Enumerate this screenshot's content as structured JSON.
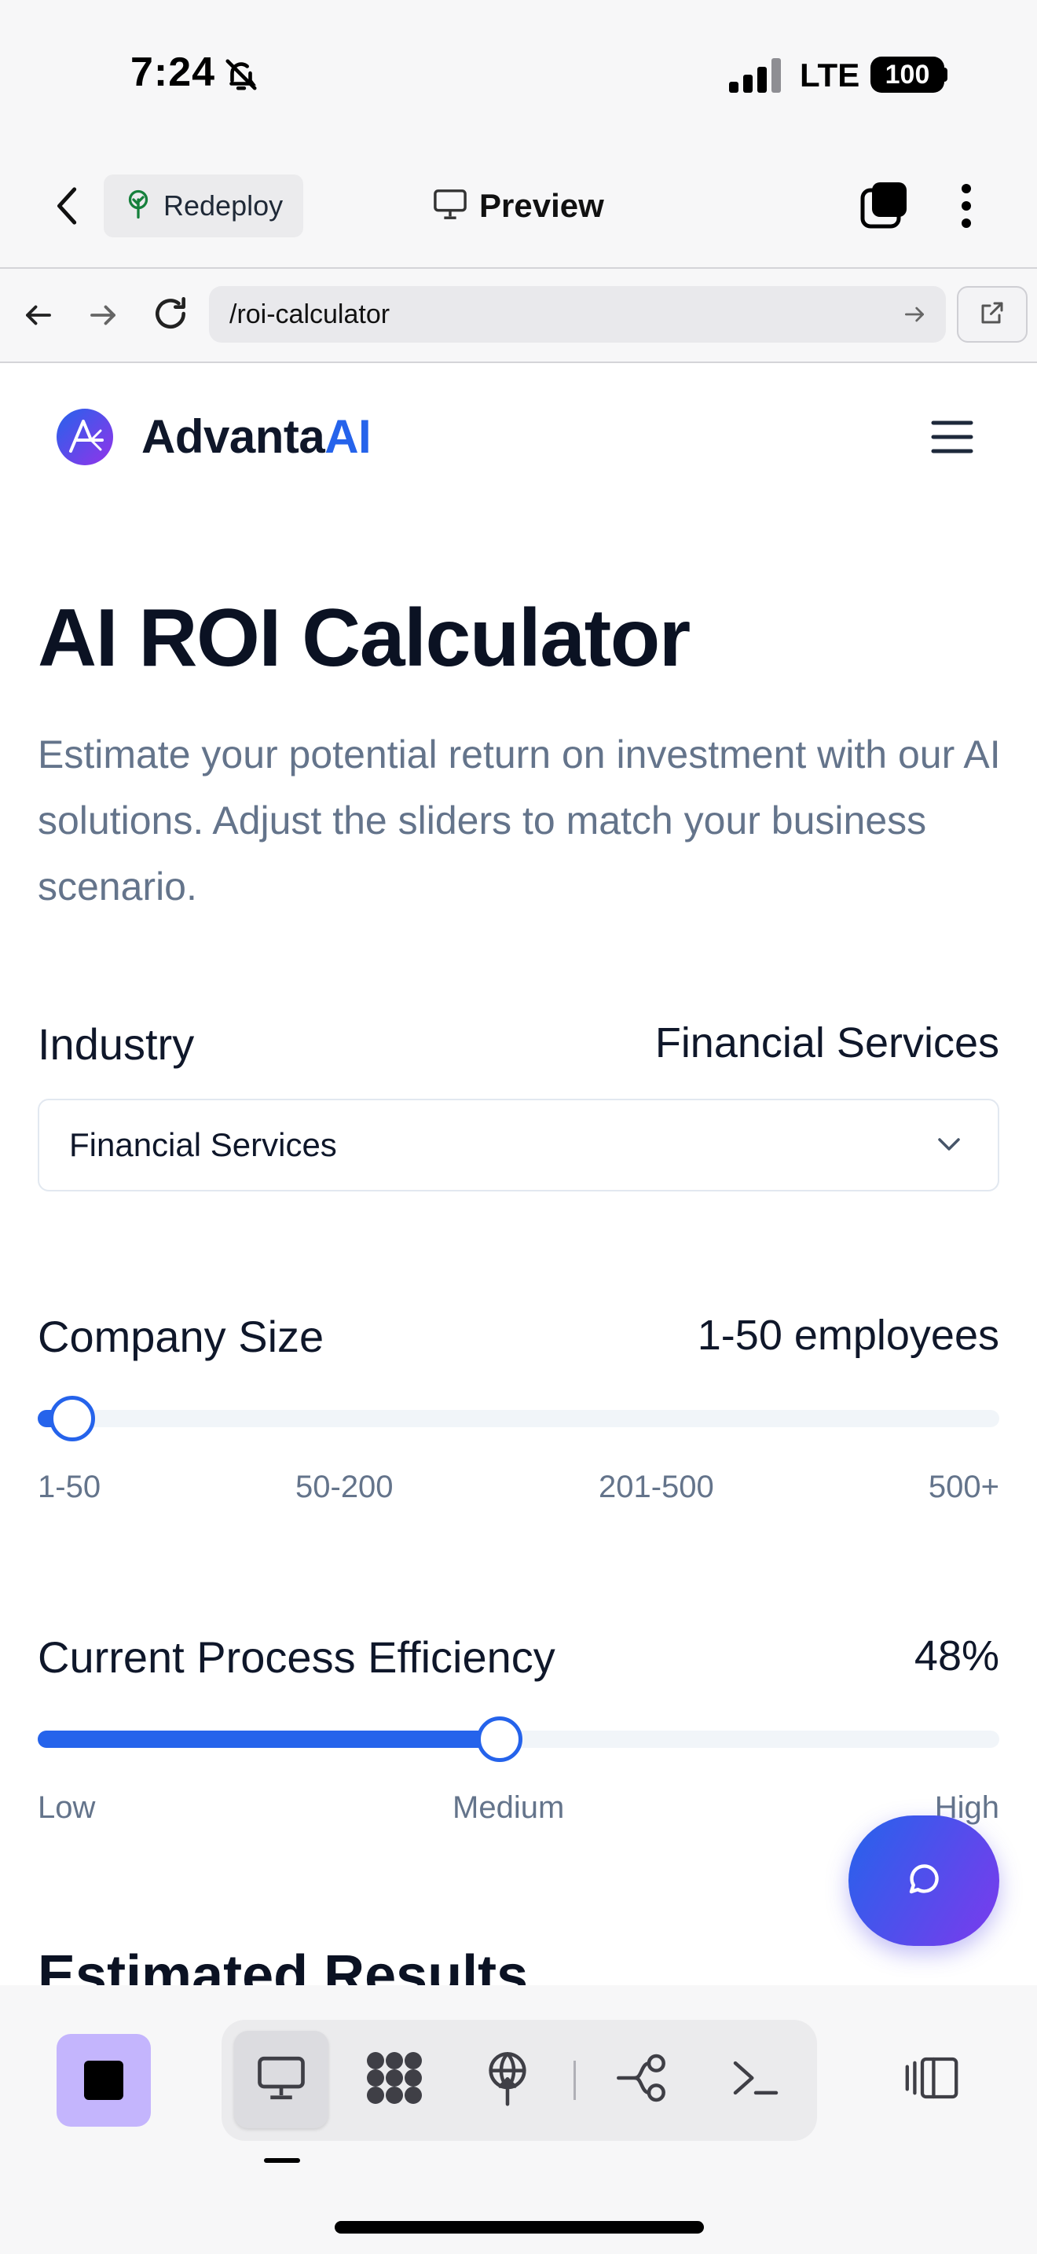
{
  "status_bar": {
    "time": "7:24",
    "network": "LTE",
    "battery": "100"
  },
  "app_bar": {
    "redeploy_label": "Redeploy",
    "preview_label": "Preview"
  },
  "browser": {
    "url": "/roi-calculator"
  },
  "site": {
    "brand_main": "Advanta",
    "brand_accent": "AI",
    "brand_color": "#2563eb"
  },
  "page": {
    "title": "AI ROI Calculator",
    "subtitle": "Estimate your potential return on investment with our AI solutions. Adjust the sliders to match your business scenario."
  },
  "industry": {
    "label": "Industry",
    "value": "Financial Services",
    "selected": "Financial Services"
  },
  "company_size": {
    "label": "Company Size",
    "value": "1-50 employees",
    "position": 0.02,
    "ticks": [
      "1-50",
      "50-200",
      "201-500",
      "500+"
    ]
  },
  "efficiency": {
    "label": "Current Process Efficiency",
    "value": "48%",
    "percent": 48,
    "levels": [
      "Low",
      "Medium",
      "High"
    ]
  },
  "results": {
    "heading": "Estimated Results"
  },
  "colors": {
    "accent": "#2563eb",
    "fab_gradient_start": "#2563eb",
    "fab_gradient_end": "#7c3aed",
    "stop_button": "#c4b5fd"
  },
  "icons": {
    "back": "chevron-left-icon",
    "redeploy": "sprout-icon",
    "preview": "monitor-icon",
    "tabs": "tabs-icon",
    "more": "more-vertical-icon",
    "nav_back": "arrow-left-icon",
    "nav_forward": "arrow-right-icon",
    "reload": "reload-icon",
    "go": "arrow-right-icon",
    "open_external": "external-link-icon",
    "menu": "hamburger-icon",
    "chat": "chat-bubble-icon",
    "stop": "stop-icon",
    "desktop": "desktop-icon",
    "grid": "grid-icon",
    "deploy": "deploy-icon",
    "flow": "flow-icon",
    "terminal": "terminal-icon",
    "panel": "panel-toggle-icon"
  }
}
